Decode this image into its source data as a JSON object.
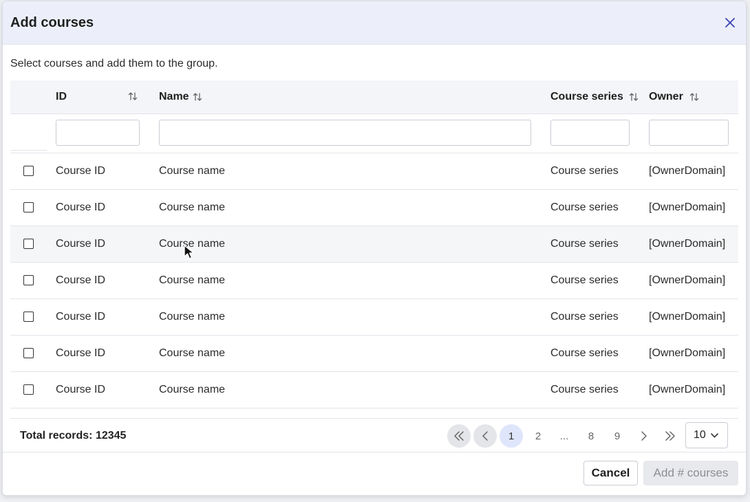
{
  "dialog": {
    "title": "Add courses",
    "subtitle": "Select courses and add them to the group."
  },
  "table": {
    "columns": [
      {
        "key": "id",
        "label": "ID"
      },
      {
        "key": "name",
        "label": "Name"
      },
      {
        "key": "series",
        "label": "Course series"
      },
      {
        "key": "owner",
        "label": "Owner"
      }
    ],
    "filters": {
      "id": "",
      "name": "",
      "series": "",
      "owner": ""
    },
    "rows": [
      {
        "id": "Course ID",
        "name": "Course name",
        "series": "Course series",
        "owner": "[OwnerDomain]"
      },
      {
        "id": "Course ID",
        "name": "Course name",
        "series": "Course series",
        "owner": "[OwnerDomain]"
      },
      {
        "id": "Course ID",
        "name": "Course name",
        "series": "Course series",
        "owner": "[OwnerDomain]"
      },
      {
        "id": "Course ID",
        "name": "Course name",
        "series": "Course series",
        "owner": "[OwnerDomain]"
      },
      {
        "id": "Course ID",
        "name": "Course name",
        "series": "Course series",
        "owner": "[OwnerDomain]"
      },
      {
        "id": "Course ID",
        "name": "Course name",
        "series": "Course series",
        "owner": "[OwnerDomain]"
      },
      {
        "id": "Course ID",
        "name": "Course name",
        "series": "Course series",
        "owner": "[OwnerDomain]"
      }
    ]
  },
  "pagination": {
    "total_label": "Total records: 12345",
    "pages": [
      "1",
      "2",
      "...",
      "8",
      "9"
    ],
    "current_page": "1",
    "page_size": "10"
  },
  "actions": {
    "cancel_label": "Cancel",
    "add_label": "Add # courses"
  },
  "colors": {
    "header_bg": "#eceff9",
    "accent": "#3b3fb6",
    "active_page_bg": "#dfe5fb",
    "disabled_button_bg": "#e8e9ec"
  },
  "icons": [
    "close-icon",
    "sort-icon",
    "checkbox",
    "first-page-icon",
    "prev-page-icon",
    "next-page-icon",
    "last-page-icon",
    "chevron-down-icon",
    "mouse-cursor-icon"
  ]
}
